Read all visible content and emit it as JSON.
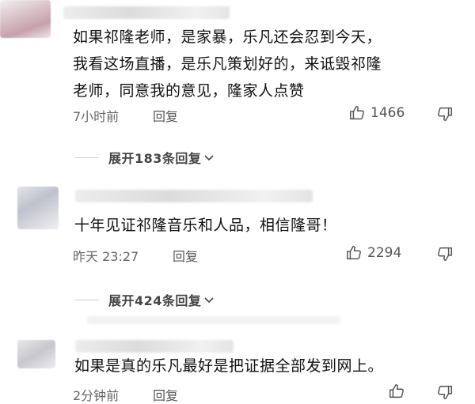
{
  "comments": [
    {
      "text_lines": [
        "如果祁隆老师，是家暴，乐凡还会忍到今天，",
        "我看这场直播，是乐凡策划好的，来诋毁祁隆",
        "老师，同意我的意见，隆家人点赞"
      ],
      "time": "7小时前",
      "reply_label": "回复",
      "likes": "1466",
      "expand_label": "展开183条回复"
    },
    {
      "text_lines": [
        "十年见证祁隆音乐和人品，相信隆哥！"
      ],
      "time": "昨天 23:27",
      "reply_label": "回复",
      "likes": "2294",
      "expand_label": "展开424条回复"
    },
    {
      "text_lines": [
        "如果是真的乐凡最好是把证据全部发到网上。"
      ],
      "time": "2分钟前",
      "reply_label": "回复",
      "likes": ""
    }
  ],
  "icons": {
    "like": "thumbs-up-icon",
    "dislike": "thumbs-down-icon",
    "expand": "chevron-down-icon"
  }
}
